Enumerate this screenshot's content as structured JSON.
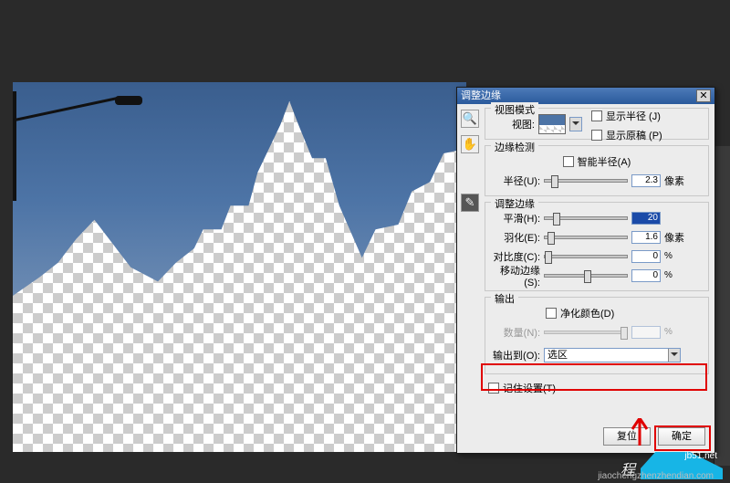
{
  "dialog": {
    "title": "调整边缘",
    "close_glyph": "✕",
    "tools": {
      "zoom_icon": "zoom-icon",
      "hand_icon": "hand-icon",
      "brush_icon": "brush-icon",
      "zoom_glyph": "🔍",
      "hand_glyph": "✋",
      "brush_glyph": "✎"
    },
    "view_mode": {
      "group": "视图模式",
      "view_label": "视图:",
      "show_radius": "显示半径 (J)",
      "show_original": "显示原稿 (P)"
    },
    "edge_detect": {
      "group": "边缘检测",
      "smart_radius": "智能半径(A)",
      "radius_label": "半径(U):",
      "radius_value": "2.3",
      "radius_unit": "像素"
    },
    "adjust": {
      "group": "调整边缘",
      "smooth_label": "平滑(H):",
      "smooth_value": "20",
      "feather_label": "羽化(E):",
      "feather_value": "1.6",
      "feather_unit": "像素",
      "contrast_label": "对比度(C):",
      "contrast_value": "0",
      "contrast_unit": "%",
      "shift_label": "移动边缘(S):",
      "shift_value": "0",
      "shift_unit": "%"
    },
    "output": {
      "group": "输出",
      "decon_label": "净化颜色(D)",
      "amount_label": "数量(N):",
      "amount_value": "",
      "amount_unit": "%",
      "output_to_label": "输出到(O):",
      "output_to_value": "选区"
    },
    "remember": "记住设置(T)",
    "reset": "复位",
    "ok": "确定"
  },
  "watermark": {
    "big": "程",
    "url": "jiaochengzhenzhendian.com",
    "jb": "jb51.net"
  }
}
